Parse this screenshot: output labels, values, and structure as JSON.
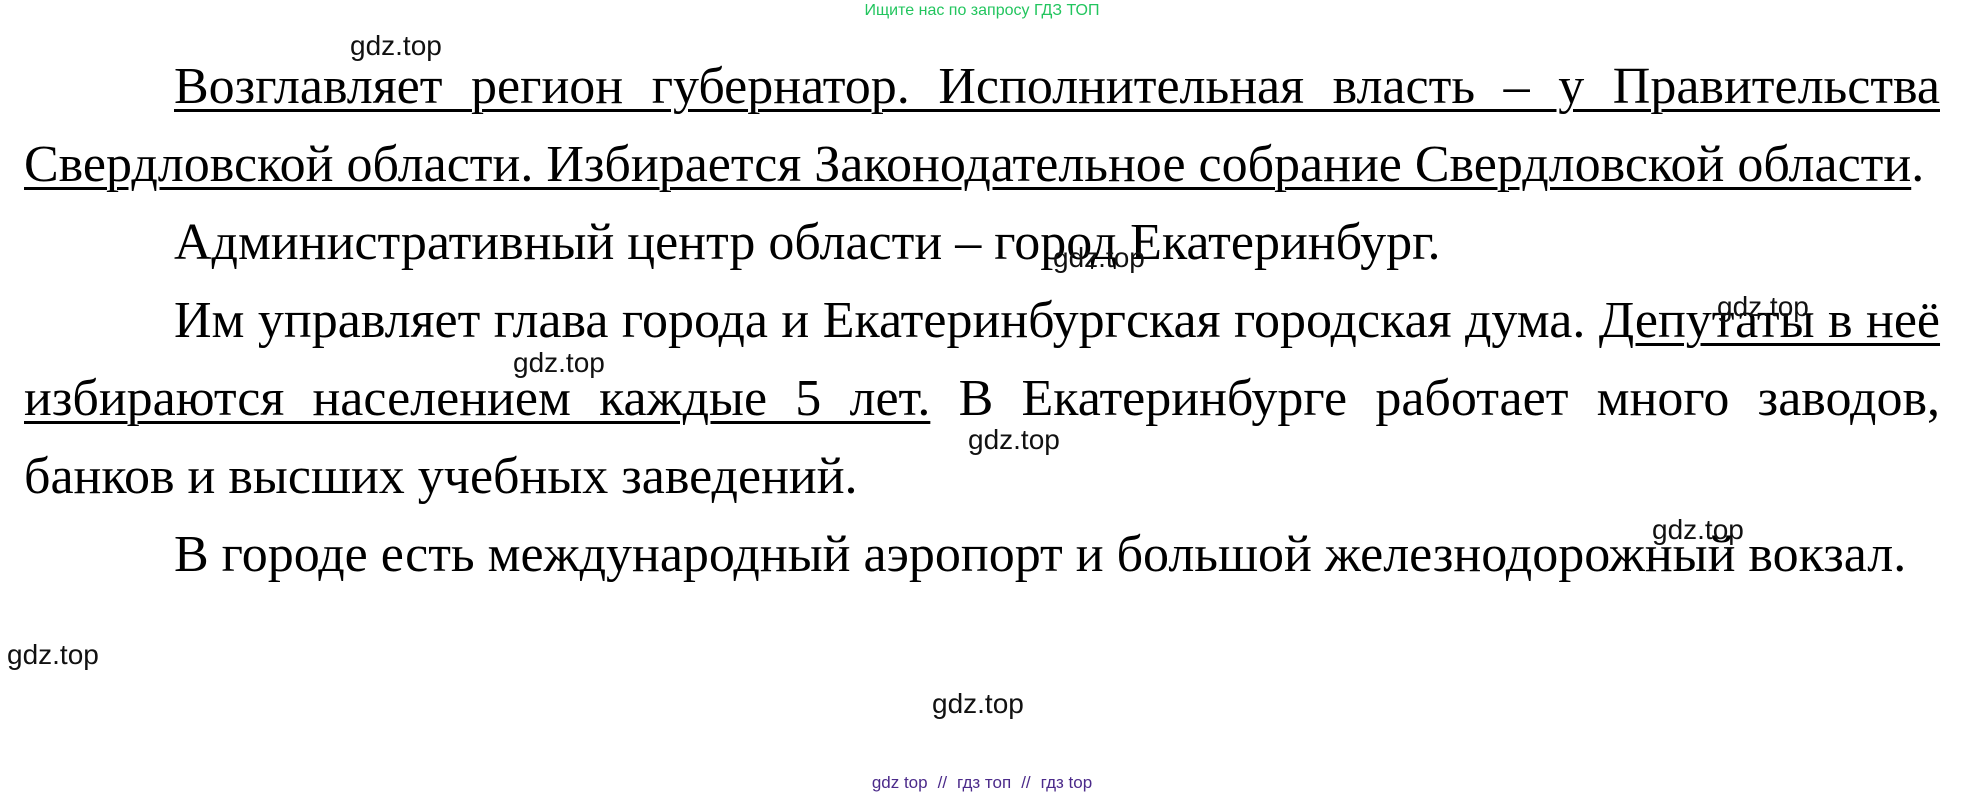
{
  "banner": "Ищите нас по запросу ГДЗ ТОП",
  "watermark_text": "gdz.top",
  "paragraphs": {
    "p1": {
      "s1": "Возглавляет регион губернатор. Исполнительная власть – у Правительства Свердловской области. Избирается Законодательное собрание Свердловской области",
      "s2": "."
    },
    "p2": "Административный центр области – город Екатеринбург.",
    "p3": {
      "s1": "Им управляет глава города и Екатеринбургская городская дума. ",
      "s2": "Депутаты в неё избираются населением каждые 5 лет.",
      "s3": " В Екатеринбурге работает много заводов, банков и высших учебных заведений."
    },
    "p4": "В городе есть международный аэропорт и большой железнодорожный вокзал."
  },
  "footer": {
    "link1": "gdz top",
    "sep": "//",
    "link2": "гдз топ",
    "link3": "гдз top"
  },
  "colors": {
    "banner": "#22c55e",
    "footer": "#4b2a8a"
  }
}
